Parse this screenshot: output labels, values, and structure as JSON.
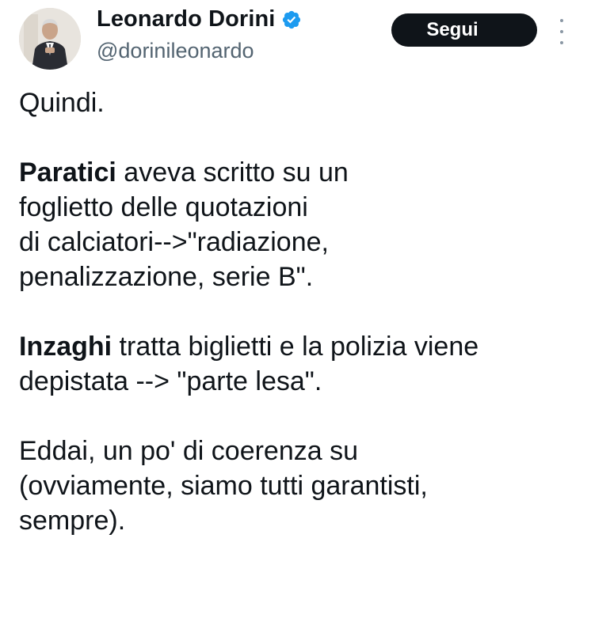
{
  "author": {
    "name": "Leonardo Dorini",
    "handle": "@dorinileonardo",
    "verified": true,
    "verified_color": "#1d9bf0"
  },
  "actions": {
    "follow_label": "Segui",
    "more_icon": "more-vertical-icon"
  },
  "tweet": {
    "line_1": "Quindi.",
    "p2_bold": "Paratici",
    "p2_line_1": " aveva scritto su un",
    "p2_line_2": "foglietto delle quotazioni",
    "p2_line_3": "di calciatori-->\"radiazione,",
    "p2_line_4": "penalizzazione, serie B\".",
    "p3_bold": "Inzaghi",
    "p3_line_1": " tratta biglietti e la polizia viene",
    "p3_line_2": "depistata --> \"parte lesa\".",
    "p4_line_1": "Eddai, un po' di coerenza su",
    "p4_line_2": "(ovviamente, siamo tutti garantisti,",
    "p4_line_3": "sempre)."
  },
  "colors": {
    "text": "#0f1419",
    "secondary": "#536471",
    "button_bg": "#0f1419",
    "button_text": "#ffffff"
  }
}
